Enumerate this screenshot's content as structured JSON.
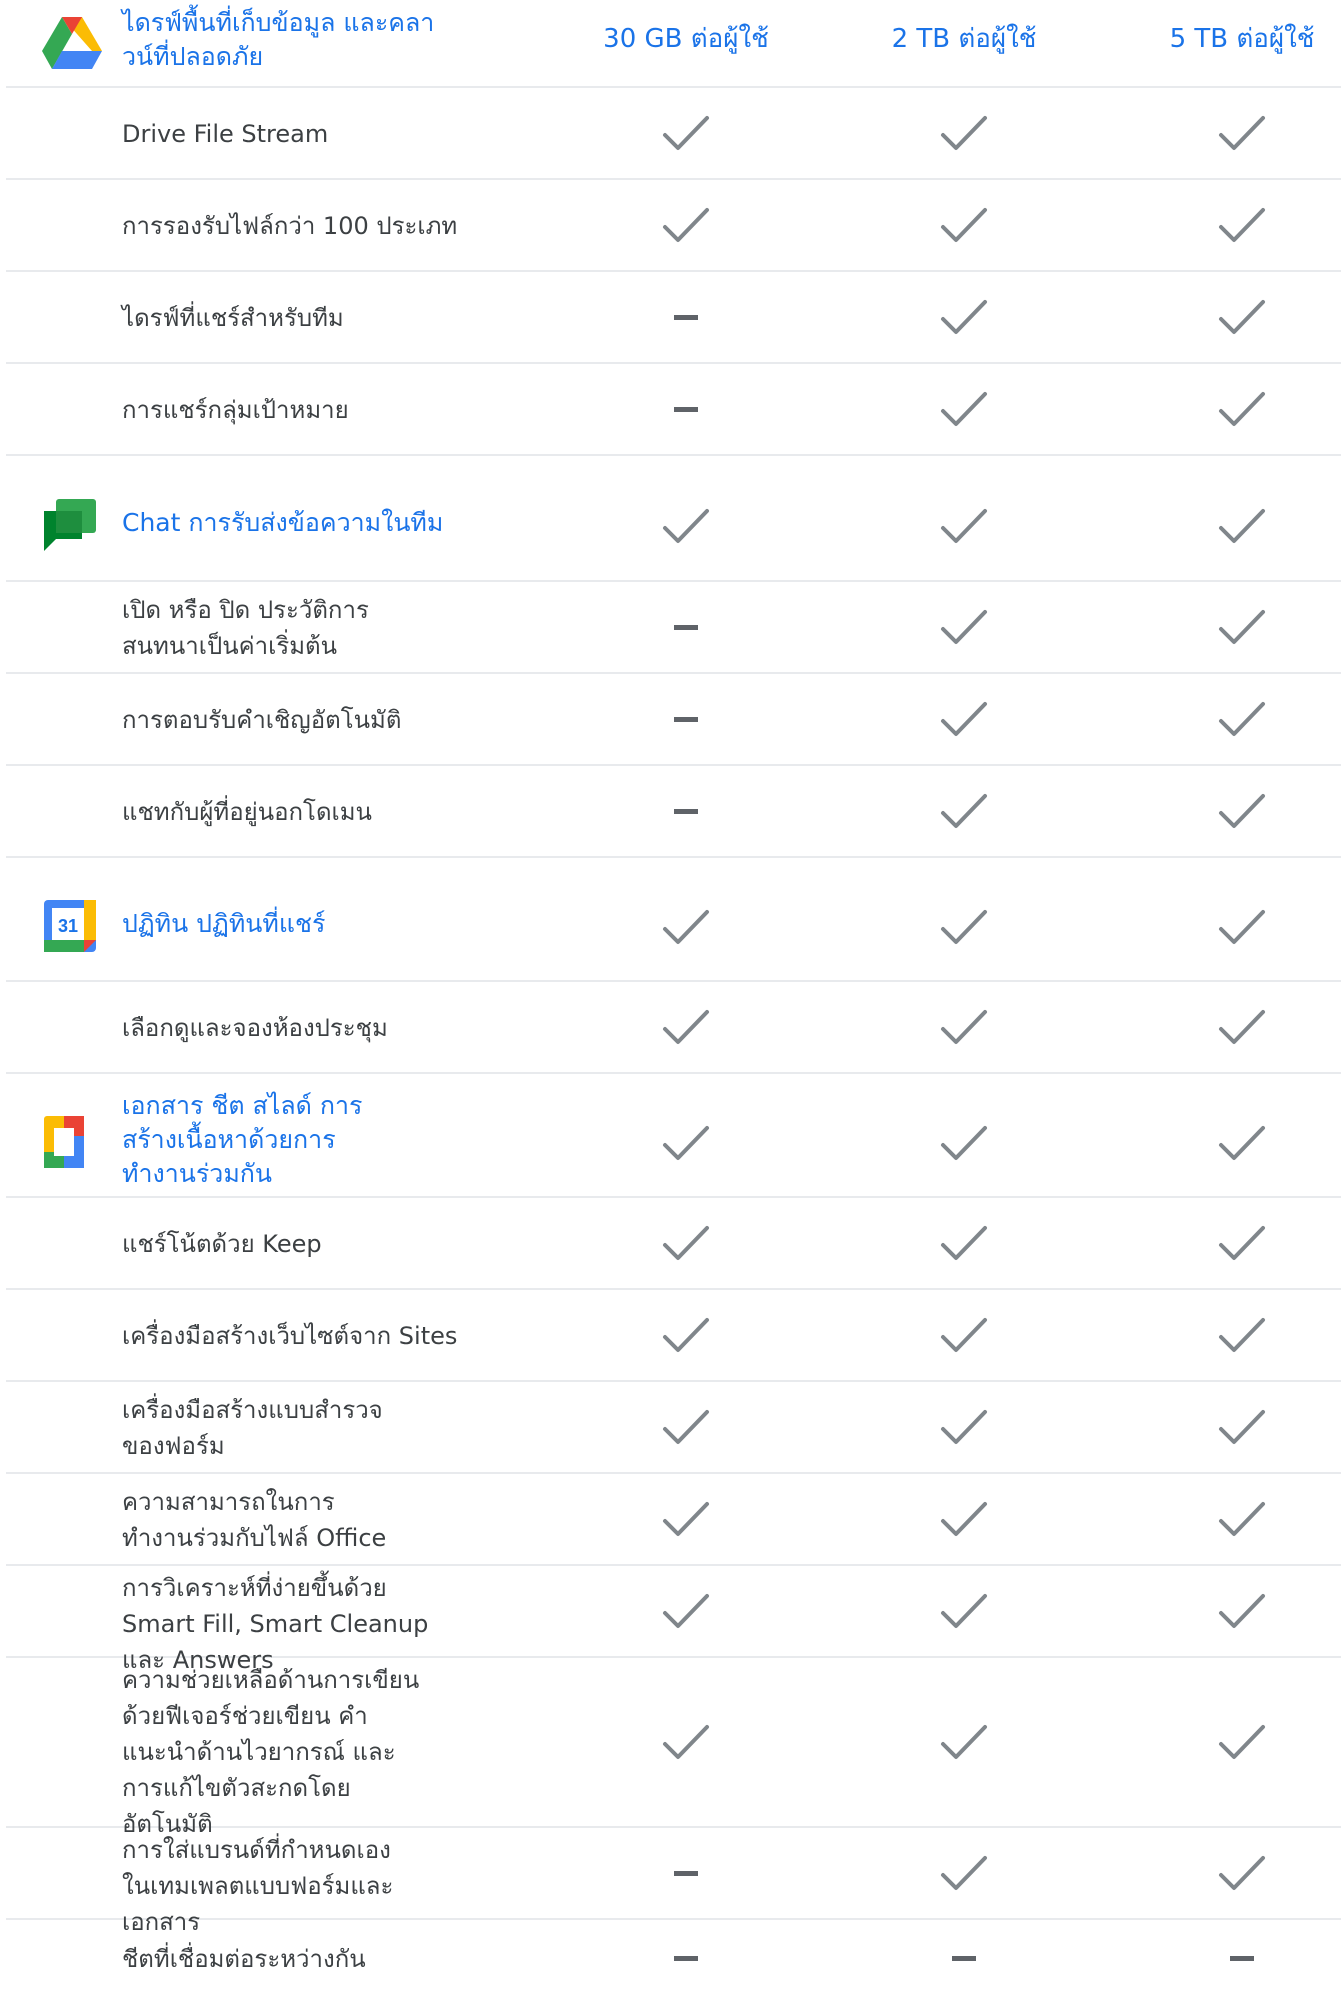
{
  "header": {
    "drive_title": "ไดรฟ์พื้นที่เก็บข้อมูล และคลาวน์ที่ปลอดภัย",
    "plans": [
      "30 GB ต่อผู้ใช้",
      "2 TB ต่อผู้ใช้",
      "5 TB ต่อผู้ใช้"
    ]
  },
  "colors": {
    "accent": "#1a73e8",
    "check": "#80868b",
    "dash": "#5f6368",
    "divider": "#e8eaed"
  },
  "icons": {
    "included": "check-icon",
    "not_included": "dash-icon"
  },
  "rows": [
    {
      "label": "Drive File Stream",
      "values": [
        true,
        true,
        true
      ]
    },
    {
      "label": "การรองรับไฟล์กว่า 100 ประเภท",
      "values": [
        true,
        true,
        true
      ]
    },
    {
      "label": "ไดรฟ์ที่แชร์สำหรับทีม",
      "values": [
        false,
        true,
        true
      ]
    },
    {
      "label": "การแชร์กลุ่มเป้าหมาย",
      "values": [
        false,
        true,
        true
      ]
    },
    {
      "label": "Chat การรับส่งข้อความในทีม",
      "section": "chat",
      "values": [
        true,
        true,
        true
      ]
    },
    {
      "label": "เปิด หรือ ปิด ประวัติการสนทนาเป็นค่าเริ่มต้น",
      "values": [
        false,
        true,
        true
      ]
    },
    {
      "label": "การตอบรับคำเชิญอัตโนมัติ",
      "values": [
        false,
        true,
        true
      ]
    },
    {
      "label": "แชทกับผู้ที่อยู่นอกโดเมน",
      "values": [
        false,
        true,
        true
      ]
    },
    {
      "label": "ปฏิทิน ปฏิทินที่แชร์",
      "section": "calendar",
      "values": [
        true,
        true,
        true
      ]
    },
    {
      "label": "เลือกดูและจองห้องประชุม",
      "values": [
        true,
        true,
        true
      ]
    },
    {
      "label": "เอกสาร ชีต สไลด์ การสร้างเนื้อหาด้วยการทำงานร่วมกัน",
      "section": "docs",
      "values": [
        true,
        true,
        true
      ]
    },
    {
      "label": "แชร์โน้ตด้วย Keep",
      "values": [
        true,
        true,
        true
      ]
    },
    {
      "label": "เครื่องมือสร้างเว็บไซต์จาก Sites",
      "values": [
        true,
        true,
        true
      ]
    },
    {
      "label": "เครื่องมือสร้างแบบสำรวจของฟอร์ม",
      "values": [
        true,
        true,
        true
      ]
    },
    {
      "label": "ความสามารถในการทำงานร่วมกับไฟล์ Office",
      "values": [
        true,
        true,
        true
      ]
    },
    {
      "label": "การวิเคราะห์ที่ง่ายขึ้นด้วย Smart Fill, Smart Cleanup และ Answers",
      "values": [
        true,
        true,
        true
      ]
    },
    {
      "label": "ความช่วยเหลือด้านการเขียนด้วยฟีเจอร์ช่วยเขียน คำแนะนำด้านไวยากรณ์ และการแก้ไขตัวสะกดโดยอัตโนมัติ",
      "values": [
        true,
        true,
        true
      ]
    },
    {
      "label": "การใส่แบรนด์ที่กำหนดเองในเทมเพลตแบบฟอร์มและเอกสาร",
      "values": [
        false,
        true,
        true
      ]
    },
    {
      "label": "ชีตที่เชื่อมต่อระหว่างกัน",
      "values": [
        false,
        false,
        false
      ]
    }
  ]
}
